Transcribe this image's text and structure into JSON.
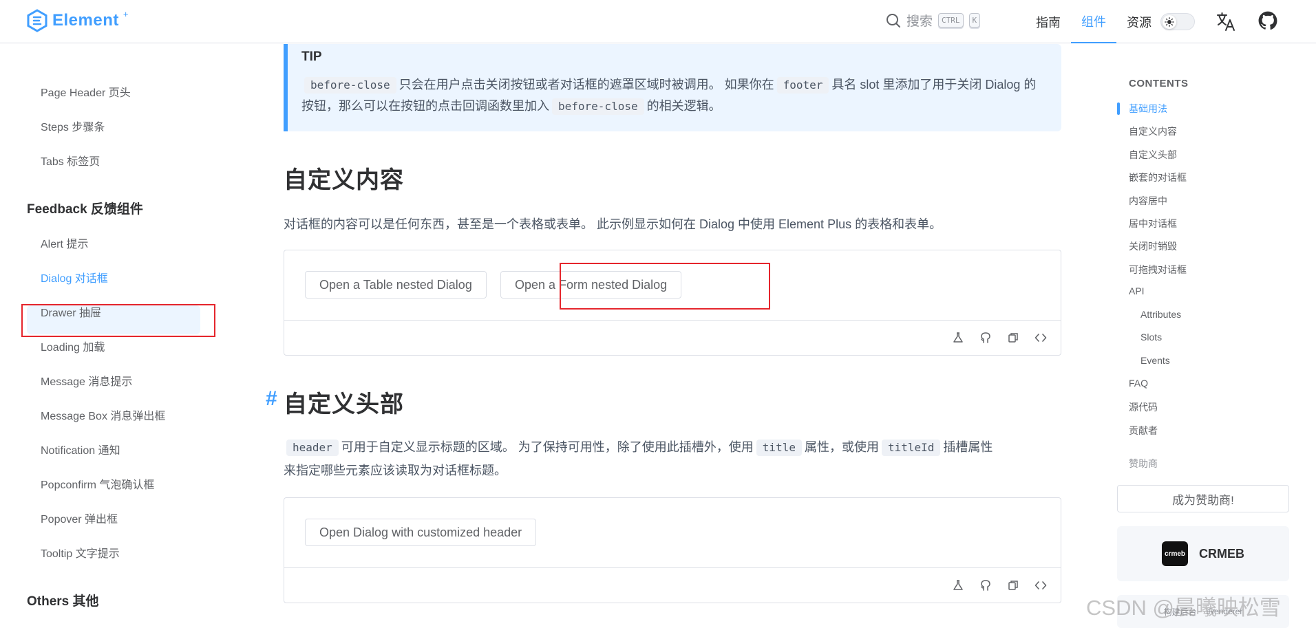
{
  "colors": {
    "primary": "#409eff",
    "highlight_border": "#e5252c",
    "tip_bg": "#ecf5ff"
  },
  "header": {
    "logo_text": "Element",
    "logo_sup": "+",
    "search_label": "搜索",
    "kbd_ctrl": "CTRL",
    "kbd_k": "K",
    "nav": [
      "指南",
      "组件",
      "资源"
    ],
    "active_nav": "组件"
  },
  "sidebar": {
    "items_top": [
      "Page Header 页头",
      "Steps 步骤条",
      "Tabs 标签页"
    ],
    "group_feedback": "Feedback 反馈组件",
    "feedback_items": [
      "Alert 提示",
      "Dialog 对话框",
      "Drawer 抽屉",
      "Loading 加载",
      "Message 消息提示",
      "Message Box 消息弹出框",
      "Notification 通知",
      "Popconfirm 气泡确认框",
      "Popover 弹出框",
      "Tooltip 文字提示"
    ],
    "active_item": "Dialog 对话框",
    "group_others": "Others 其他"
  },
  "main": {
    "tip": {
      "title": "TIP",
      "code1": "before-close",
      "text1": "只会在用户点击关闭按钮或者对话框的遮罩区域时被调用。 如果你在",
      "code2": "footer",
      "text2": "具名 slot 里添加了用于关闭 Dialog 的",
      "text3": "按钮，那么可以在按钮的点击回调函数里加入",
      "code3": "before-close",
      "text4": "的相关逻辑。"
    },
    "section1": {
      "title": "自定义内容",
      "description": "对话框的内容可以是任何东西，甚至是一个表格或表单。 此示例显示如何在 Dialog 中使用 Element Plus 的表格和表单。",
      "button_table": "Open a Table nested Dialog",
      "button_form": "Open a Form nested Dialog"
    },
    "section2": {
      "anchor": "#",
      "title": "自定义头部",
      "code1": "header",
      "text1": "可用于自定义显示标题的区域。 为了保持可用性，除了使用此插槽外，使用",
      "code2": "title",
      "text2": "属性，或使用",
      "code3": "titleId",
      "text3": "插槽属性",
      "text4": "来指定哪些元素应该读取为对话框标题。",
      "button": "Open Dialog with customized header"
    }
  },
  "toc": {
    "title": "CONTENTS",
    "items": [
      "基础用法",
      "自定义内容",
      "自定义头部",
      "嵌套的对话框",
      "内容居中",
      "居中对话框",
      "关闭时销毁",
      "可拖拽对话框",
      "API"
    ],
    "api_sub": [
      "Attributes",
      "Slots",
      "Events"
    ],
    "tail": [
      "FAQ",
      "源代码",
      "贡献者"
    ],
    "active_item": "基础用法",
    "sponsor_label": "赞助商",
    "sponsor_button": "成为赞助商!",
    "sponsor_crmeb_logo": "crmeb",
    "sponsor_crmeb": "CRMEB",
    "sponsor2_a": "构建后台",
    "sponsor2_b": "iRenderer"
  },
  "watermark": "CSDN @晨曦映松雪"
}
